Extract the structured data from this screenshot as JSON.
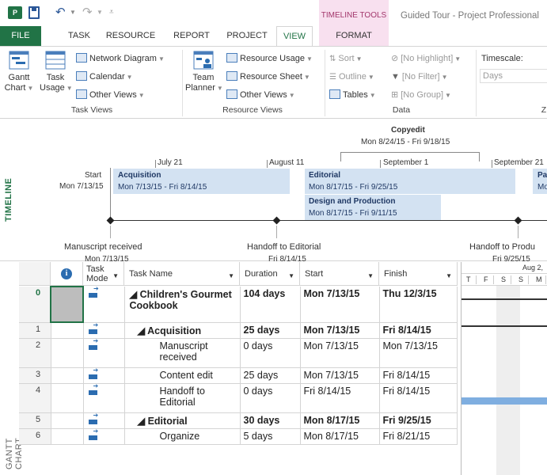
{
  "titlebar": {
    "app_icon": "P",
    "context_title": "TIMELINE TOOLS",
    "window_title": "Guided Tour - Project Professional"
  },
  "tabs": [
    {
      "label": "FILE"
    },
    {
      "label": "TASK"
    },
    {
      "label": "RESOURCE"
    },
    {
      "label": "REPORT"
    },
    {
      "label": "PROJECT"
    },
    {
      "label": "VIEW"
    },
    {
      "label": "FORMAT"
    }
  ],
  "ribbon": {
    "gantt_chart": "Gantt\nChart",
    "task_usage": "Task\nUsage",
    "network_diagram": "Network Diagram",
    "calendar": "Calendar",
    "task_other_views": "Other Views",
    "task_views_label": "Task Views",
    "team_planner": "Team\nPlanner",
    "resource_usage": "Resource Usage",
    "resource_sheet": "Resource Sheet",
    "resource_other_views": "Other Views",
    "resource_views_label": "Resource Views",
    "sort": "Sort",
    "outline": "Outline",
    "tables": "Tables",
    "highlight": "[No Highlight]",
    "filter": "[No Filter]",
    "group": "[No Group]",
    "data_label": "Data",
    "timescale_label": "Timescale:",
    "timescale_value": "Days",
    "zoom_label": "Z"
  },
  "timeline": {
    "side_label": "TIMELINE",
    "start_label": "Start",
    "start_date": "Mon 7/13/15",
    "date_markers": [
      "July 21",
      "August 11",
      "September 1",
      "September 21"
    ],
    "callout_title": "Copyedit",
    "callout_dates": "Mon 8/24/15 - Fri 9/18/15",
    "bars": [
      {
        "name": "Acquisition",
        "dates": "Mon 7/13/15 - Fri 8/14/15"
      },
      {
        "name": "Editorial",
        "dates": "Mon 8/17/15 - Fri 9/25/15"
      },
      {
        "name": "Design and Production",
        "dates": "Mon 8/17/15 - Fri 9/11/15"
      },
      {
        "name": "Pa",
        "dates": "Mo"
      }
    ],
    "milestones": [
      {
        "name": "Manuscript received",
        "date": "Mon 7/13/15"
      },
      {
        "name": "Handoff to Editorial",
        "date": "Fri 8/14/15"
      },
      {
        "name": "Handoff to Produ",
        "date": "Fri 9/25/15"
      }
    ]
  },
  "gantt": {
    "side_label": "GANTT CHART",
    "headers": {
      "mode": "Task\nMode",
      "name": "Task Name",
      "duration": "Duration",
      "start": "Start",
      "finish": "Finish"
    },
    "timescale_top": "Aug 2,",
    "timescale_days": [
      "T",
      "F",
      "S",
      "S",
      "M"
    ],
    "rows": [
      {
        "id": "0",
        "name": "◢ Children's Gourmet Cookbook",
        "duration": "104 days",
        "start": "Mon 7/13/15",
        "finish": "Thu 12/3/15",
        "level": 0,
        "summary": true
      },
      {
        "id": "1",
        "name": "◢ Acquisition",
        "duration": "25 days",
        "start": "Mon 7/13/15",
        "finish": "Fri 8/14/15",
        "level": 1,
        "summary": true
      },
      {
        "id": "2",
        "name": "Manuscript received",
        "duration": "0 days",
        "start": "Mon 7/13/15",
        "finish": "Mon 7/13/15",
        "level": 2,
        "summary": false
      },
      {
        "id": "3",
        "name": "Content edit",
        "duration": "25 days",
        "start": "Mon 7/13/15",
        "finish": "Fri 8/14/15",
        "level": 2,
        "summary": false
      },
      {
        "id": "4",
        "name": "Handoff to Editorial",
        "duration": "0 days",
        "start": "Fri 8/14/15",
        "finish": "Fri 8/14/15",
        "level": 2,
        "summary": false
      },
      {
        "id": "5",
        "name": "◢ Editorial",
        "duration": "30 days",
        "start": "Mon 8/17/15",
        "finish": "Fri 9/25/15",
        "level": 1,
        "summary": true
      },
      {
        "id": "6",
        "name": "Organize",
        "duration": "5 days",
        "start": "Mon 8/17/15",
        "finish": "Fri 8/21/15",
        "level": 2,
        "summary": false
      }
    ]
  }
}
